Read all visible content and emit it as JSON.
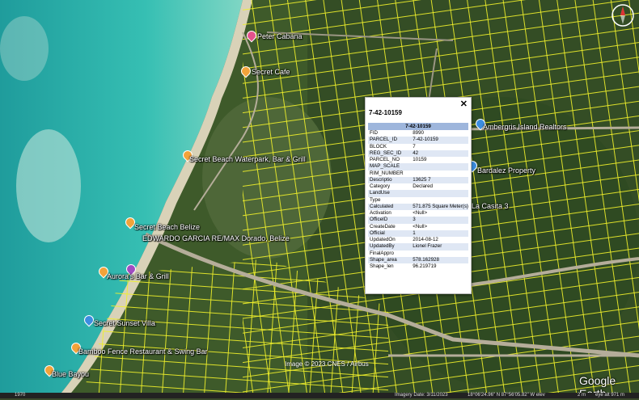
{
  "popup": {
    "title": "7-42-10159",
    "close_symbol": "✕",
    "table_header": "7-42-10159",
    "rows": [
      {
        "key": "FID",
        "value": "8990"
      },
      {
        "key": "PARCEL_ID",
        "value": "7-42-10159"
      },
      {
        "key": "BLOCK",
        "value": "7"
      },
      {
        "key": "REG_SEC_ID",
        "value": "42"
      },
      {
        "key": "PARCEL_NO",
        "value": "10159"
      },
      {
        "key": "MAP_SCALE",
        "value": ""
      },
      {
        "key": "RIM_NUMBER",
        "value": ""
      },
      {
        "key": "Descriptio",
        "value": "13625 7"
      },
      {
        "key": "Category",
        "value": "Declared"
      },
      {
        "key": "LandUse",
        "value": ""
      },
      {
        "key": "Type",
        "value": ""
      },
      {
        "key": "Calculated",
        "value": "571.875 Square Meter(s)"
      },
      {
        "key": "Activation",
        "value": "<Null>"
      },
      {
        "key": "OfficeID",
        "value": "3"
      },
      {
        "key": "CreateDate",
        "value": "<Null>"
      },
      {
        "key": "Official",
        "value": "1"
      },
      {
        "key": "UpdatedOn",
        "value": "2014-08-12"
      },
      {
        "key": "UpdatedBy",
        "value": "Lionel Frazer"
      },
      {
        "key": "FinalAppro",
        "value": ""
      },
      {
        "key": "Shape_area",
        "value": "578.162928"
      },
      {
        "key": "Shape_len",
        "value": "96.219719"
      }
    ]
  },
  "places": {
    "p1": "Peter Cabana",
    "p2": "Secret Cafe",
    "p3": "Secret Beach Waterpark, Bar & Grill",
    "p4": "Secret Beach Belize",
    "p5": "EDWARDO GARCIA RE/MAX Dorado, Belize",
    "p6": "Aurora's Bar & Grill",
    "p7": "Secret Sunset Villa",
    "p8": "Bamboo Fence Restaurant & Swing Bar",
    "p9": "Blue Bayou",
    "p10": "Ambergris Island Realtors",
    "p11": "Bardalez Property",
    "p12": "La Casita 3"
  },
  "attribution": "Image © 2023 CNES / Airbus",
  "logo": "Google Earth",
  "status": {
    "year": "1970",
    "imagery_date": "Imagery Date: 3/11/2023",
    "coords": "18°06'24.96\" N   87°56'05.82\" W   elev",
    "elev_value": "2 m",
    "eye_alt": "eye alt   971 m"
  },
  "colors": {
    "parcel_lines": "#f0f02a",
    "sea": "#2fb2ad",
    "land": "#3e5a2a",
    "roads": "#b5ad9a",
    "popup_header": "#9eb6dc",
    "popup_alt_row": "#dfe7f4"
  }
}
